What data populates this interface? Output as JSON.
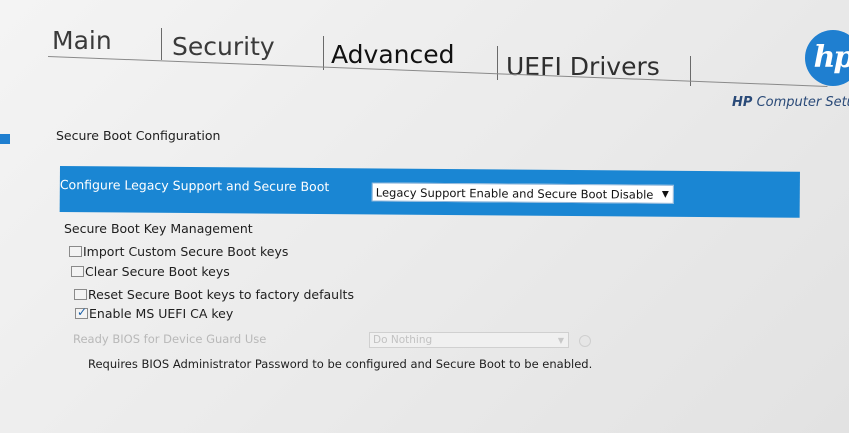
{
  "tabs": [
    {
      "label": "Main"
    },
    {
      "label": "Security"
    },
    {
      "label": "Advanced"
    },
    {
      "label": "UEFI Drivers"
    }
  ],
  "active_tab": "Advanced",
  "brand": {
    "logo_text": "hp",
    "company": "HP",
    "product": "Computer Setup"
  },
  "section_title": "Secure Boot Configuration",
  "legacy_row": {
    "label": "Configure Legacy Support and Secure Boot",
    "selected_value": "Legacy Support Enable and Secure Boot Disable"
  },
  "key_management": {
    "title": "Secure Boot Key Management",
    "options": [
      {
        "label": "Import Custom Secure Boot keys",
        "checked": false
      },
      {
        "label": "Clear Secure Boot keys",
        "checked": false
      },
      {
        "label": "Reset Secure Boot keys to factory defaults",
        "checked": false
      },
      {
        "label": "Enable MS UEFI CA key",
        "checked": true
      }
    ]
  },
  "device_guard": {
    "label": "Ready BIOS for Device Guard Use",
    "selected_value": "Do Nothing",
    "enabled": false
  },
  "note": "Requires BIOS Administrator Password to be configured and Secure Boot to be enabled.",
  "colors": {
    "highlight": "#1a86d3",
    "brand_blue": "#1f7fd0",
    "disabled_text": "#b8b8b8"
  }
}
